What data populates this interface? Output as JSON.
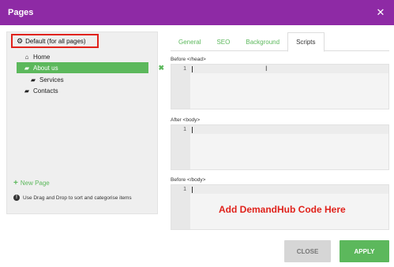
{
  "dialog": {
    "title": "Pages",
    "close_glyph": "✕"
  },
  "sidebar": {
    "default_label": "Default (for all pages)",
    "items": [
      {
        "label": "Home",
        "icon": "home-icon",
        "glyph": "⌂"
      },
      {
        "label": "About us",
        "icon": "folder-open-icon",
        "glyph": "▰"
      },
      {
        "label": "Services",
        "icon": "folder-open-icon",
        "glyph": "▰"
      },
      {
        "label": "Contacts",
        "icon": "folder-open-icon",
        "glyph": "▰"
      }
    ],
    "delete_glyph": "✖",
    "new_page_label": "New Page",
    "hint": "Use Drag and Drop to sort and categorise items"
  },
  "tabs": [
    "General",
    "SEO",
    "Background",
    "Scripts"
  ],
  "active_tab": "Scripts",
  "scripts": {
    "before_head_label": "Before </head>",
    "after_body_label": "After <body>",
    "before_body_label": "Before </body>",
    "line_number": "1",
    "annotation": "Add DemandHub Code Here"
  },
  "footer": {
    "close_label": "CLOSE",
    "apply_label": "APPLY"
  },
  "colors": {
    "titlebar": "#8e2aa5",
    "accent": "#5cb85c",
    "highlight_red": "#e0221b"
  }
}
